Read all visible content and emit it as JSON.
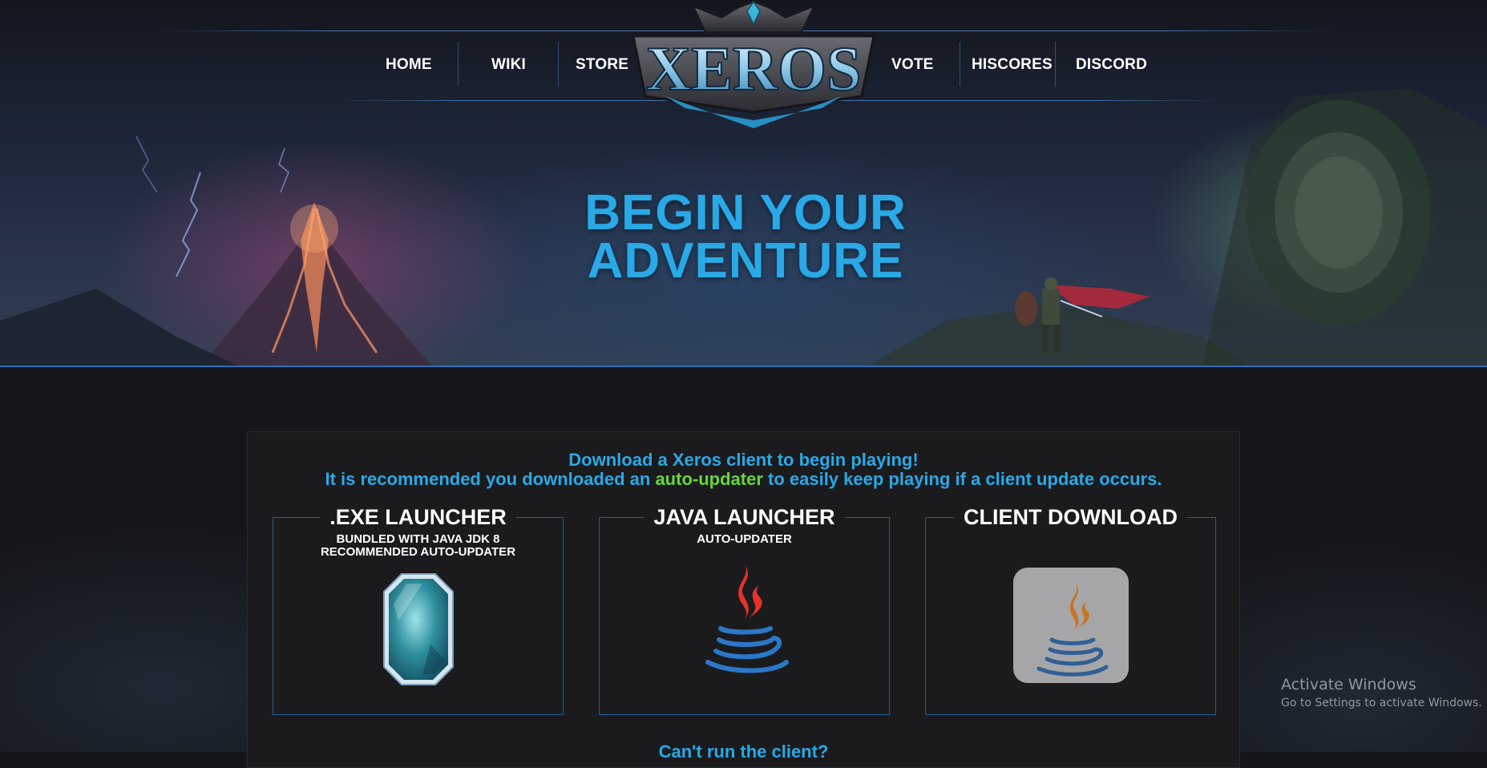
{
  "nav": {
    "items": [
      {
        "label": "HOME"
      },
      {
        "label": "WIKI"
      },
      {
        "label": "STORE"
      },
      {
        "label": "VOTE"
      },
      {
        "label": "HISCORES"
      },
      {
        "label": "DISCORD"
      }
    ],
    "logo_text": "XEROS"
  },
  "hero": {
    "line1": "BEGIN YOUR",
    "line2": "ADVENTURE"
  },
  "download": {
    "headline": "Download a Xeros client to begin playing!",
    "recommend_prefix": "It is recommended you downloaded an ",
    "recommend_highlight": "auto-updater",
    "recommend_suffix": " to easily keep playing if a client update occurs.",
    "cards": [
      {
        "title": ".EXE LAUNCHER",
        "sub1": "BUNDLED WITH JAVA JDK 8",
        "sub2": "RECOMMENDED AUTO-UPDATER",
        "icon": "crystal-icon"
      },
      {
        "title": "JAVA LAUNCHER",
        "sub1": "AUTO-UPDATER",
        "sub2": "",
        "icon": "java-icon"
      },
      {
        "title": "CLIENT DOWNLOAD",
        "sub1": "",
        "sub2": "",
        "icon": "java-file-icon"
      }
    ],
    "help_text": "Can't run the client?"
  },
  "watermark": {
    "title": "Activate Windows",
    "subtitle": "Go to Settings to activate Windows."
  },
  "colors": {
    "accent_blue": "#2aa9e6",
    "accent_green": "#67d63a",
    "card_border": "#1f5f9c"
  }
}
